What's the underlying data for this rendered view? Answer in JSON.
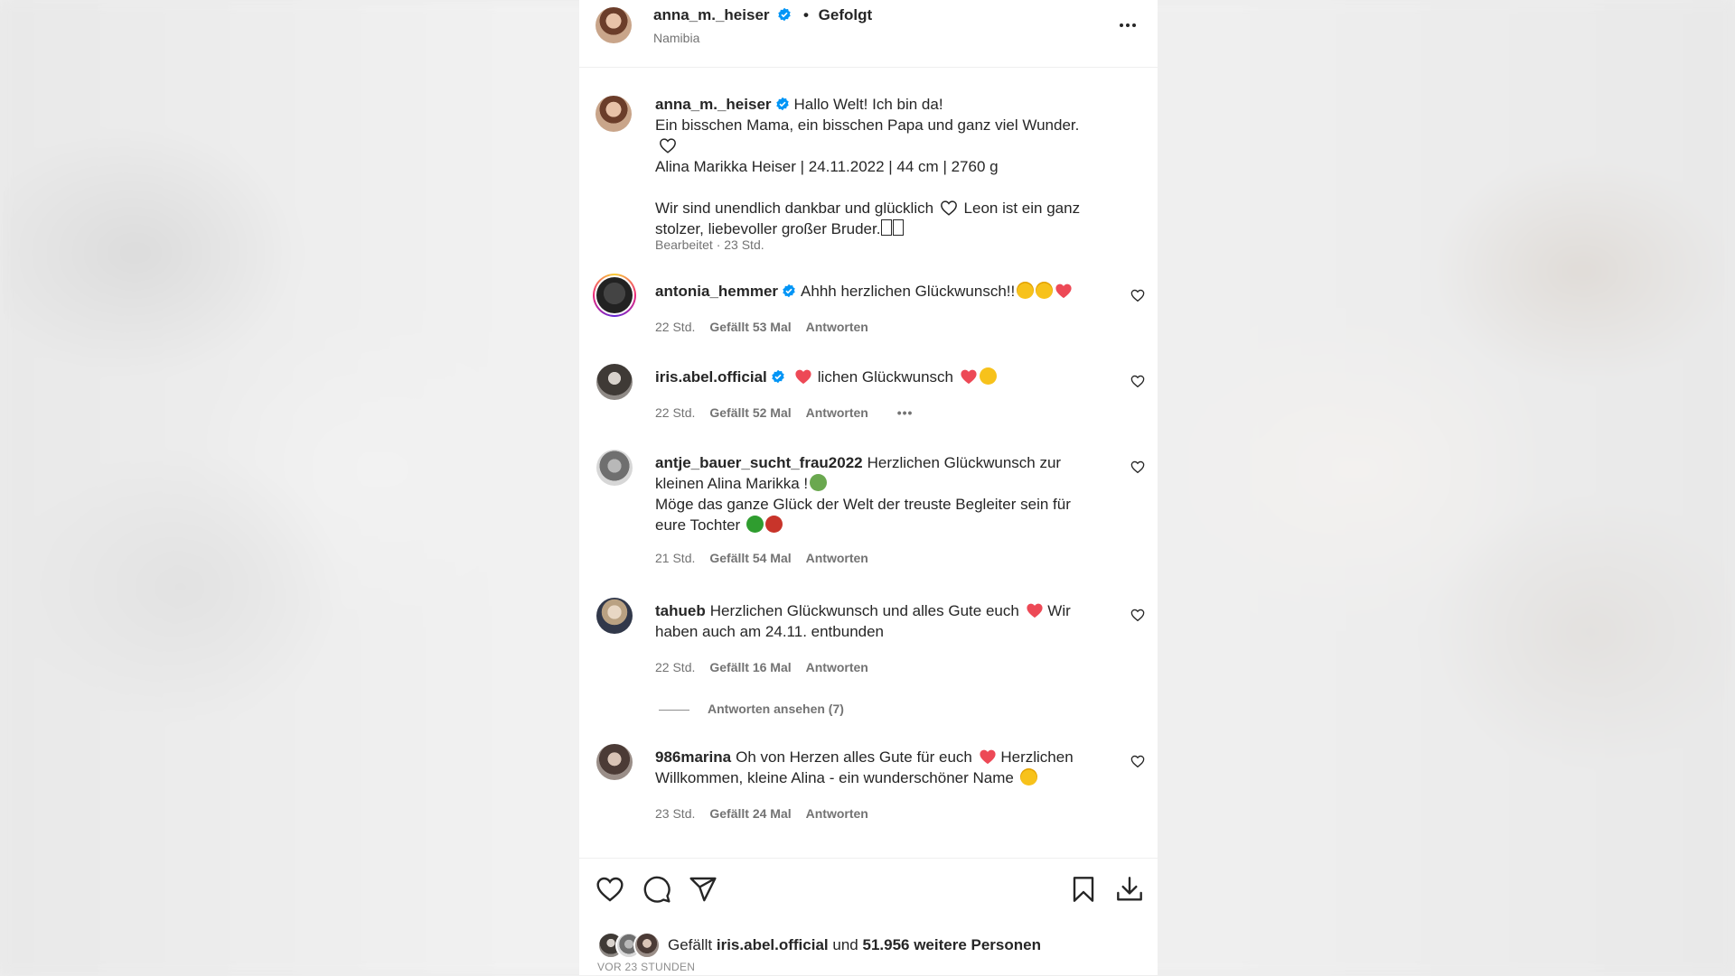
{
  "header": {
    "username": "anna_m._heiser",
    "separator": "•",
    "follow_status": "Gefolgt",
    "location": "Namibia"
  },
  "caption": {
    "username": "anna_m._heiser",
    "line1": "Hallo Welt! Ich bin da!",
    "line2": "Ein bisschen Mama, ein bisschen Papa und ganz viel Wunder.",
    "line3": "Alina Marikka Heiser | 24.11.2022 | 44 cm | 2760 g",
    "line4": "Wir sind unendlich dankbar und glücklich",
    "line4b": "Leon ist ein ganz stolzer, liebevoller großer Bruder.",
    "meta": "Bearbeitet · 23 Std."
  },
  "comments": [
    {
      "username": "antonia_hemmer",
      "verified": true,
      "text": "Ahhh herzlichen Glückwunsch!!",
      "time": "22 Std.",
      "likes": "Gefällt 53 Mal",
      "reply": "Antworten"
    },
    {
      "username": "iris.abel.official",
      "verified": true,
      "text": "lichen Glückwunsch",
      "time": "22 Std.",
      "likes": "Gefällt 52 Mal",
      "reply": "Antworten"
    },
    {
      "username": "antje_bauer_sucht_frau2022",
      "verified": false,
      "text": "Herzlichen Glückwunsch zur kleinen Alina Marikka !",
      "text2": "Möge das ganze Glück der Welt der treuste Begleiter sein für eure Tochter",
      "time": "21 Std.",
      "likes": "Gefällt 54 Mal",
      "reply": "Antworten"
    },
    {
      "username": "tahueb",
      "verified": false,
      "text": "Herzlichen Glückwunsch und alles Gute euch",
      "text2": "Wir haben auch am 24.11. entbunden",
      "time": "22 Std.",
      "likes": "Gefällt 16 Mal",
      "reply": "Antworten",
      "view_replies": "Antworten ansehen (7)"
    },
    {
      "username": "986marina",
      "verified": false,
      "text": "Oh von Herzen alles Gute für euch",
      "text2": "Herzlichen Willkommen, kleine Alina - ein wunderschöner Name",
      "time": "23 Std.",
      "likes": "Gefällt 24 Mal",
      "reply": "Antworten"
    }
  ],
  "likes_line": {
    "prefix": "Gefällt",
    "user": "iris.abel.official",
    "middle": "und",
    "count": "51.956 weitere Personen"
  },
  "timestamp": "VOR 23 STUNDEN",
  "colors": {
    "verified": "#0095f6",
    "heart_red": "#ed4956",
    "muted": "#737373"
  },
  "icons": [
    "more-options-icon",
    "verified-badge-icon",
    "heart-outline-icon",
    "comment-icon",
    "share-icon",
    "bookmark-icon",
    "download-icon"
  ]
}
